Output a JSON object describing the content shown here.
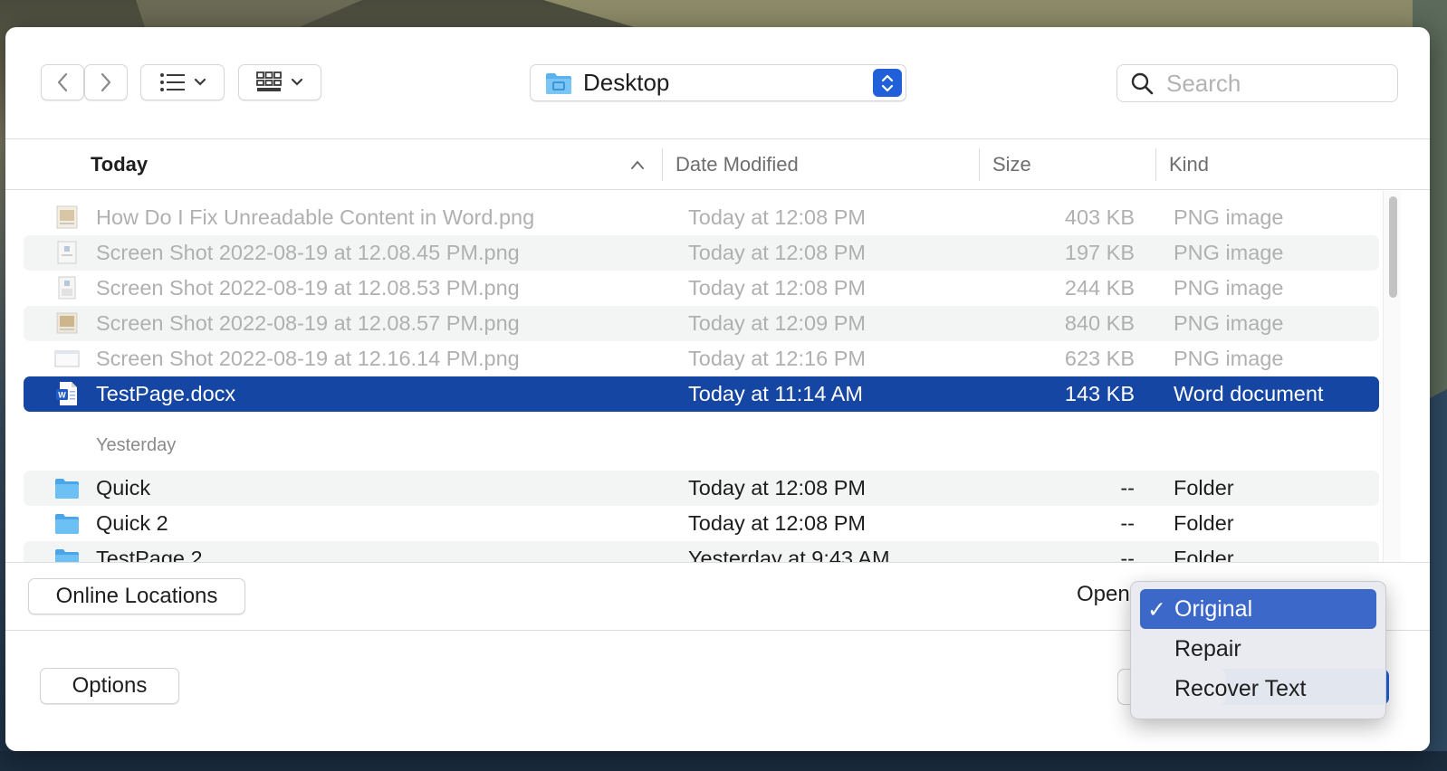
{
  "toolbar": {
    "location": "Desktop",
    "search_placeholder": "Search"
  },
  "columns": {
    "name": "Today",
    "date": "Date Modified",
    "size": "Size",
    "kind": "Kind"
  },
  "today_files": [
    {
      "name": "How Do I Fix Unreadable Content in Word.png",
      "date": "Today at 12:08 PM",
      "size": "403 KB",
      "kind": "PNG image",
      "icon": "image-thumbnail-icon"
    },
    {
      "name": "Screen Shot 2022-08-19 at 12.08.45 PM.png",
      "date": "Today at 12:08 PM",
      "size": "197 KB",
      "kind": "PNG image",
      "icon": "image-thumbnail-icon"
    },
    {
      "name": "Screen Shot 2022-08-19 at 12.08.53 PM.png",
      "date": "Today at 12:08 PM",
      "size": "244 KB",
      "kind": "PNG image",
      "icon": "image-thumbnail-icon"
    },
    {
      "name": "Screen Shot 2022-08-19 at 12.08.57 PM.png",
      "date": "Today at 12:09 PM",
      "size": "840 KB",
      "kind": "PNG image",
      "icon": "image-thumbnail-icon"
    },
    {
      "name": "Screen Shot 2022-08-19 at 12.16.14 PM.png",
      "date": "Today at 12:16 PM",
      "size": "623 KB",
      "kind": "PNG image",
      "icon": "image-thumbnail-icon"
    },
    {
      "name": "TestPage.docx",
      "date": "Today at 11:14 AM",
      "size": "143 KB",
      "kind": "Word document",
      "icon": "word-document-icon"
    }
  ],
  "yesterday_label": "Yesterday",
  "yesterday_files": [
    {
      "name": "Quick",
      "date": "Today at 12:08 PM",
      "size": "--",
      "kind": "Folder",
      "icon": "folder-icon"
    },
    {
      "name": "Quick 2",
      "date": "Today at 12:08 PM",
      "size": "--",
      "kind": "Folder",
      "icon": "folder-icon"
    },
    {
      "name": "TestPage 2",
      "date": "Yesterday at 9:43 AM",
      "size": "--",
      "kind": "Folder",
      "icon": "folder-icon"
    }
  ],
  "footer": {
    "online_locations": "Online Locations",
    "open_label": "Open",
    "options": "Options"
  },
  "open_menu": {
    "check": "✓",
    "items": [
      "Original",
      "Repair",
      "Recover Text"
    ],
    "selected": "Original"
  },
  "colors": {
    "selection": "#1646a3",
    "accent": "#2160d9",
    "menu_highlight": "#3c68c9"
  }
}
